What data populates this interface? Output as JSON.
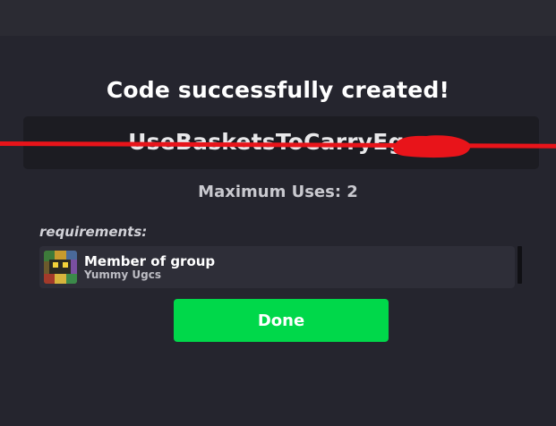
{
  "dialog": {
    "title": "Code successfully created!",
    "code": "UseBasketsToCarryEggs",
    "max_uses_label": "Maximum Uses: 2",
    "requirements_label": "requirements:",
    "requirements": [
      {
        "type": "Member of group",
        "group": "Yummy Ugcs",
        "icon": "group-avatar-icon"
      }
    ],
    "done_label": "Done"
  },
  "colors": {
    "background": "#25252e",
    "code_box": "#1c1c22",
    "done_button": "#00d84a",
    "redaction": "#e8141a"
  }
}
